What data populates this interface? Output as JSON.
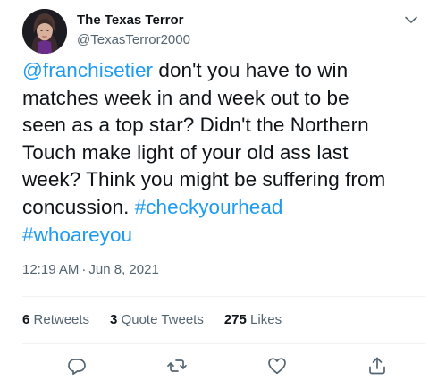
{
  "author": {
    "name": "The Texas Terror",
    "handle": "@TexasTerror2000",
    "avatar_icon": "user-avatar-photo"
  },
  "tweet": {
    "lines": [
      [
        {
          "text": "@franchisetier",
          "type": "mention"
        },
        {
          "text": " don't you have to win",
          "type": "text"
        }
      ],
      [
        {
          "text": "matches week in and week out to be",
          "type": "text"
        }
      ],
      [
        {
          "text": "seen as a top star? Didn't the Northern",
          "type": "text"
        }
      ],
      [
        {
          "text": "Touch make light of your old ass last",
          "type": "text"
        }
      ],
      [
        {
          "text": "week? Think you might be suffering from",
          "type": "text"
        }
      ],
      [
        {
          "text": "concussion. ",
          "type": "text"
        },
        {
          "text": "#checkyourhead",
          "type": "hashtag"
        }
      ],
      [
        {
          "text": "#whoareyou",
          "type": "hashtag"
        }
      ]
    ],
    "time": "12:19 AM",
    "separator": "·",
    "date": "Jun 8, 2021"
  },
  "stats": {
    "retweets": {
      "count": "6",
      "label": "Retweets"
    },
    "quote_tweets": {
      "count": "3",
      "label": "Quote Tweets"
    },
    "likes": {
      "count": "275",
      "label": "Likes"
    }
  },
  "icons": {
    "more": "chevron-down-icon",
    "reply": "reply-icon",
    "retweet": "retweet-icon",
    "like": "heart-icon",
    "share": "share-icon"
  },
  "colors": {
    "link": "#1d9bf0",
    "text": "#0f1419",
    "secondary": "#536471",
    "divider": "#eff3f4"
  }
}
